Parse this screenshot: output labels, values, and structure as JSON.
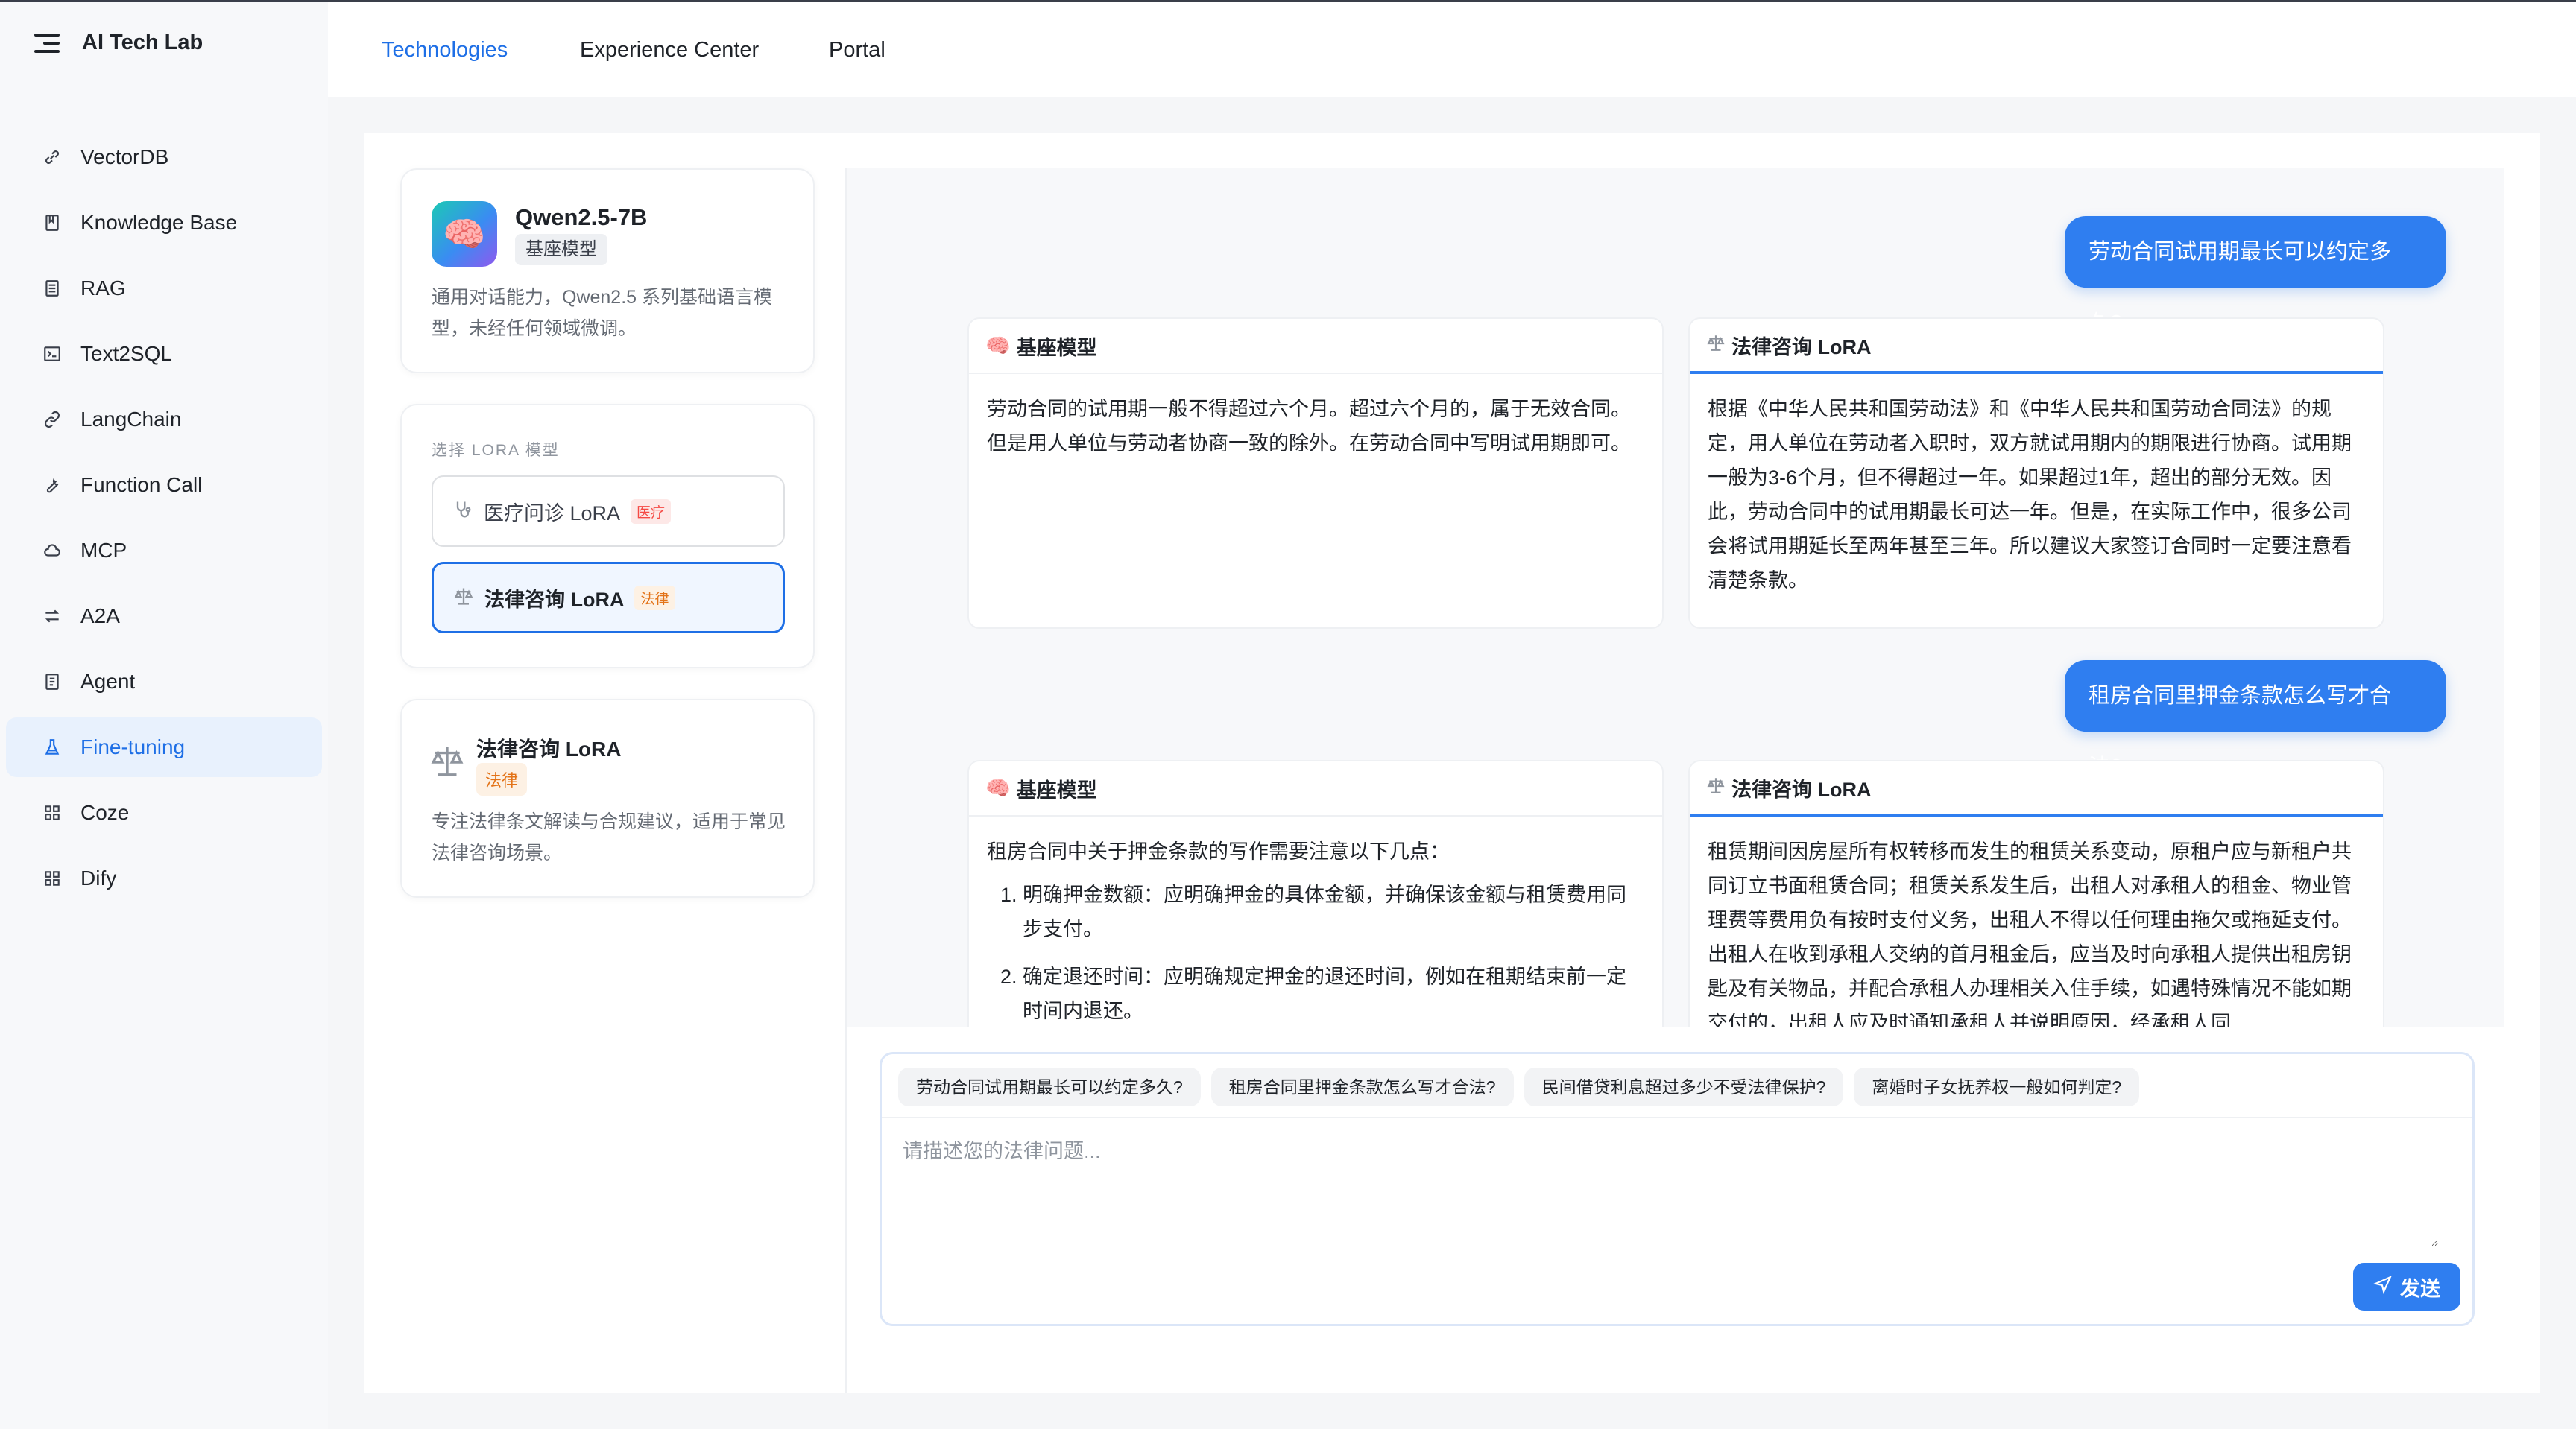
{
  "app": {
    "title": "AI Tech Lab"
  },
  "sidebar": {
    "items": [
      {
        "label": "VectorDB",
        "icon": "link-icon"
      },
      {
        "label": "Knowledge Base",
        "icon": "book-icon"
      },
      {
        "label": "RAG",
        "icon": "list-icon"
      },
      {
        "label": "Text2SQL",
        "icon": "terminal-icon"
      },
      {
        "label": "LangChain",
        "icon": "chain-icon"
      },
      {
        "label": "Function Call",
        "icon": "wrench-icon"
      },
      {
        "label": "MCP",
        "icon": "cloud-icon"
      },
      {
        "label": "A2A",
        "icon": "swap-icon"
      },
      {
        "label": "Agent",
        "icon": "agent-icon"
      },
      {
        "label": "Fine-tuning",
        "icon": "flask-icon",
        "active": true
      },
      {
        "label": "Coze",
        "icon": "grid-icon"
      },
      {
        "label": "Dify",
        "icon": "grid-icon"
      }
    ]
  },
  "tabs": [
    {
      "label": "Technologies",
      "active": true
    },
    {
      "label": "Experience Center"
    },
    {
      "label": "Portal"
    }
  ],
  "model": {
    "name": "Qwen2.5-7B",
    "tag": "基座模型",
    "description": "通用对话能力，Qwen2.5 系列基础语言模型，未经任何领域微调。"
  },
  "lora": {
    "section_label": "选择 LORA 模型",
    "options": [
      {
        "label": "医疗问诊 LoRA",
        "tag": "医疗",
        "tag_color": "#f54a45"
      },
      {
        "label": "法律咨询 LoRA",
        "tag": "法律",
        "tag_color": "#e37318",
        "selected": true
      }
    ]
  },
  "detail": {
    "name": "法律咨询 LoRA",
    "tag": "法律",
    "description": "专注法律条文解读与合规建议，适用于常见法律咨询场景。"
  },
  "chat": {
    "base_label": "基座模型",
    "lora_label": "法律咨询 LoRA",
    "turns": [
      {
        "question": "劳动合同试用期最长可以约定多久?",
        "base_answer": "劳动合同的试用期一般不得超过六个月。超过六个月的，属于无效合同。但是用人单位与劳动者协商一致的除外。在劳动合同中写明试用期即可。",
        "lora_answer": "根据《中华人民共和国劳动法》和《中华人民共和国劳动合同法》的规定，用人单位在劳动者入职时，双方就试用期内的期限进行协商。试用期一般为3-6个月，但不得超过一年。如果超过1年，超出的部分无效。因此，劳动合同中的试用期最长可达一年。但是，在实际工作中，很多公司会将试用期延长至两年甚至三年。所以建议大家签订合同时一定要注意看清楚条款。"
      },
      {
        "question": "租房合同里押金条款怎么写才合法?",
        "base_intro": "租房合同中关于押金条款的写作需要注意以下几点：",
        "base_list": [
          "明确押金数额：应明确押金的具体金额，并确保该金额与租赁费用同步支付。",
          "确定退还时间：应明确规定押金的退还时间，例如在租期结束前一定时间内退还。"
        ],
        "lora_answer": "租赁期间因房屋所有权转移而发生的租赁关系变动，原租户应与新租户共同订立书面租赁合同；租赁关系发生后，出租人对承租人的租金、物业管理费等费用负有按时支付义务，出租人不得以任何理由拖欠或拖延支付。出租人在收到承租人交纳的首月租金后，应当及时向承租人提供出租房钥匙及有关物品，并配合承租人办理相关入住手续，如遇特殊情况不能如期交付的，出租人应及时通知承租人并说明原因，经承租人同"
      }
    ]
  },
  "composer": {
    "suggestions": [
      "劳动合同试用期最长可以约定多久?",
      "租房合同里押金条款怎么写才合法?",
      "民间借贷利息超过多少不受法律保护?",
      "离婚时子女抚养权一般如何判定?"
    ],
    "placeholder": "请描述您的法律问题...",
    "send_label": "发送"
  },
  "colors": {
    "accent": "#1e6fe6",
    "bubble": "#2f7ef0",
    "sidebar_bg": "#f7f8fa"
  }
}
